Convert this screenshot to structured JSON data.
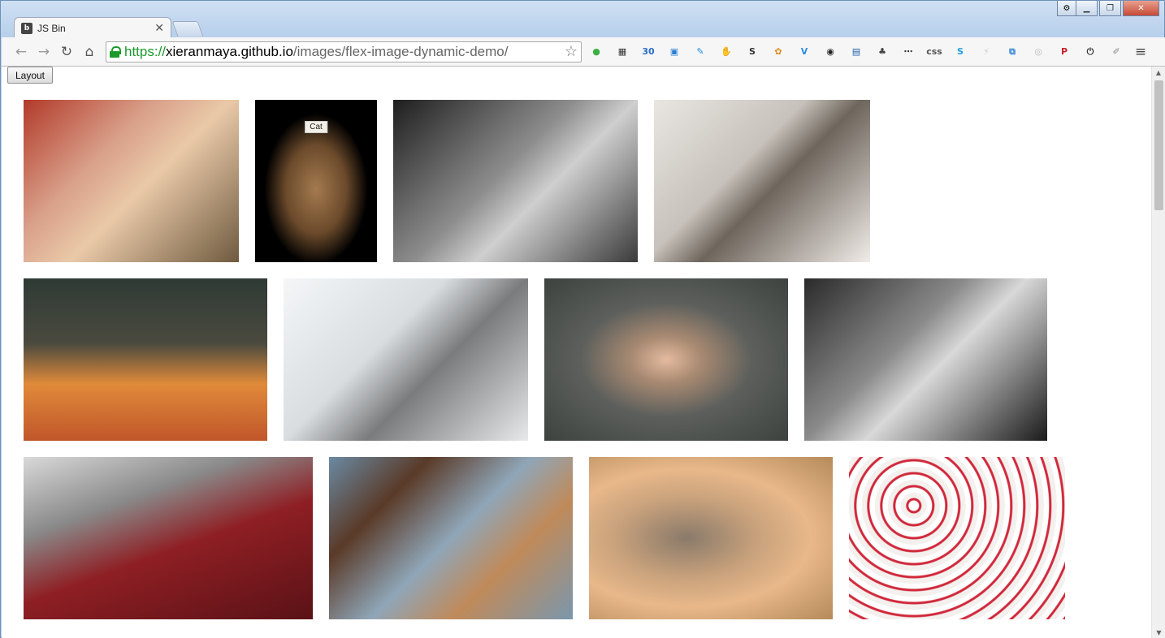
{
  "window": {
    "controls": {
      "minimize": "▁",
      "restore": "❐",
      "close": "✕",
      "profile": "⚙"
    }
  },
  "tab": {
    "title": "JS Bin",
    "close": "✕",
    "favicon": "b"
  },
  "toolbar": {
    "back": "←",
    "forward": "→",
    "reload": "↻",
    "home": "⌂",
    "url_scheme": "https://",
    "url_host": "xieranmaya.github.io",
    "url_path": "/images/flex-image-dynamic-demo/",
    "bookmark_star": "☆",
    "extensions": [
      {
        "name": "green-dot-extension-icon",
        "glyph": "●",
        "color": "#3cb043"
      },
      {
        "name": "qr-code-extension-icon",
        "glyph": "▦",
        "color": "#333333"
      },
      {
        "name": "calendar-extension-icon",
        "glyph": "30",
        "color": "#2a6cc8"
      },
      {
        "name": "window-extension-icon",
        "glyph": "▣",
        "color": "#2a7fd4"
      },
      {
        "name": "pen-extension-icon",
        "glyph": "✎",
        "color": "#1f8fe0"
      },
      {
        "name": "adblock-extension-icon",
        "glyph": "✋",
        "color": "#d42020"
      },
      {
        "name": "s-extension-icon",
        "glyph": "S",
        "color": "#333333"
      },
      {
        "name": "fruit-extension-icon",
        "glyph": "✿",
        "color": "#e08a1e"
      },
      {
        "name": "v-extension-icon",
        "glyph": "V",
        "color": "#2d8ee0"
      },
      {
        "name": "glasses-extension-icon",
        "glyph": "◉",
        "color": "#222222"
      },
      {
        "name": "book-extension-icon",
        "glyph": "▤",
        "color": "#1c5fa8"
      },
      {
        "name": "evernote-extension-icon",
        "glyph": "♣",
        "color": "#444444"
      },
      {
        "name": "dots-extension-icon",
        "glyph": "⋯",
        "color": "#333333"
      },
      {
        "name": "css-extension-icon",
        "glyph": "css",
        "color": "#555555"
      },
      {
        "name": "skype-extension-icon",
        "glyph": "S",
        "color": "#1fa0e0"
      },
      {
        "name": "lightning-extension-icon",
        "glyph": "⚡",
        "color": "#cccccc"
      },
      {
        "name": "resize-extension-icon",
        "glyph": "⧉",
        "color": "#2a7fd4"
      },
      {
        "name": "target-extension-icon",
        "glyph": "◎",
        "color": "#bbbbbb"
      },
      {
        "name": "pinterest-extension-icon",
        "glyph": "P",
        "color": "#cb2027"
      },
      {
        "name": "power-extension-icon",
        "glyph": "⏻",
        "color": "#333333"
      },
      {
        "name": "feather-extension-icon",
        "glyph": "✐",
        "color": "#888888"
      }
    ],
    "menu": "≡"
  },
  "page": {
    "layout_button": "Layout",
    "rows": [
      [
        {
          "name": "photo-laughing-girl",
          "w": 265,
          "bg": "linear-gradient(135deg,#b23a2a 0%,#d9a08a 35%,#e9c9a8 55%,#6f5a3f 100%)"
        },
        {
          "name": "photo-dog-cat-label",
          "w": 150,
          "bg": "radial-gradient(ellipse at 50% 55%,#a47a4f 0%,#6b4a2b 35%,#000 60%)",
          "label": "Cat"
        },
        {
          "name": "photo-baby-feet",
          "w": 301,
          "bg": "linear-gradient(135deg,#1e1e1e 0%,#8e8e8e 45%,#cfcfcf 60%,#3a3a3a 100%)"
        },
        {
          "name": "photo-jumping-kittens",
          "w": 266,
          "bg": "linear-gradient(135deg,#e9e6e2 0%,#c7c2bb 40%,#6e655c 55%,#f0ece8 100%)"
        }
      ],
      [
        {
          "name": "photo-cat-on-cushion",
          "w": 300,
          "bg": "linear-gradient(180deg,#2f3a35 0%,#4a4a3f 40%,#e08a3a 65%,#c0562a 100%)"
        },
        {
          "name": "photo-silver-tabby-kitten",
          "w": 301,
          "bg": "linear-gradient(135deg,#f4f6f8 0%,#d9dde0 40%,#7a7b7d 60%,#e8e9ea 100%)"
        },
        {
          "name": "photo-girl-in-burlap",
          "w": 300,
          "bg": "radial-gradient(ellipse at 50% 50%,#e4bba0 0%,#a98a72 20%,#5c5f5c 50%,#3d423f 100%)"
        },
        {
          "name": "photo-bw-kitten-rolling",
          "w": 299,
          "bg": "linear-gradient(135deg,#2a2a2a 0%,#8a8a8a 40%,#d8d8d8 55%,#1a1a1a 100%)"
        }
      ],
      [
        {
          "name": "photo-tabby-on-red-carpet",
          "w": 356,
          "bg": "linear-gradient(160deg,#d9d9d9 0%,#8a8a8a 30%,#8e1f24 55%,#5a1216 100%)"
        },
        {
          "name": "photo-calico-kitten-under-chair",
          "w": 300,
          "bg": "linear-gradient(135deg,#6a8aa3 0%,#5a3a28 25%,#8fa6b8 50%,#c08a5a 70%,#7a97ad 100%)"
        },
        {
          "name": "photo-tabby-closeup",
          "w": 300,
          "bg": "radial-gradient(ellipse at 40% 50%,#8a7a6a 0%,#c9a27c 35%,#e8b88a 60%,#b58a5a 100%)"
        },
        {
          "name": "photo-lucky-cat-figurines",
          "w": 266,
          "bg": "repeating-radial-gradient(circle at 30% 30%,#ffffff 0 6px,#d0283a 7px 9px,#f3f0ee 10px 16px)"
        }
      ]
    ]
  }
}
